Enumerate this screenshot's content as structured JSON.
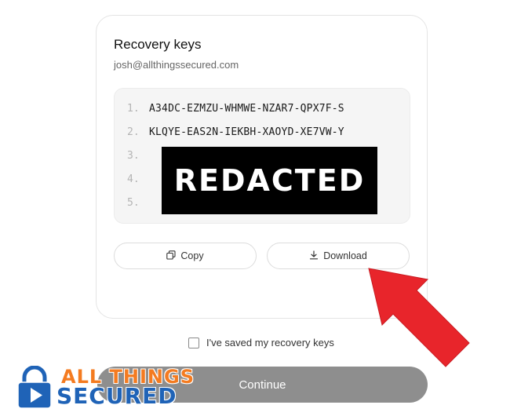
{
  "dialog": {
    "title": "Recovery keys",
    "email": "josh@allthingssecured.com"
  },
  "keys": [
    {
      "num": "1.",
      "code": "A34DC-EZMZU-WHMWE-NZAR7-QPX7F-S"
    },
    {
      "num": "2.",
      "code": "KLQYE-EAS2N-IEKBH-XAOYD-XE7VW-Y"
    },
    {
      "num": "3.",
      "code": ""
    },
    {
      "num": "4.",
      "code": ""
    },
    {
      "num": "5.",
      "code": ""
    }
  ],
  "redaction": "REDACTED",
  "buttons": {
    "copy": {
      "label": "Copy",
      "icon": "copy-icon"
    },
    "download": {
      "label": "Download",
      "icon": "download-icon"
    }
  },
  "confirm": {
    "label": "I've saved my recovery keys",
    "checked": false
  },
  "continue": {
    "label": "Continue",
    "enabled": false
  },
  "annotation": {
    "arrow_color": "#e8252b"
  },
  "watermark": {
    "line1": "ALL THINGS",
    "line2": "SECURED",
    "colors": [
      "#f47b20",
      "#1f63b7"
    ]
  }
}
